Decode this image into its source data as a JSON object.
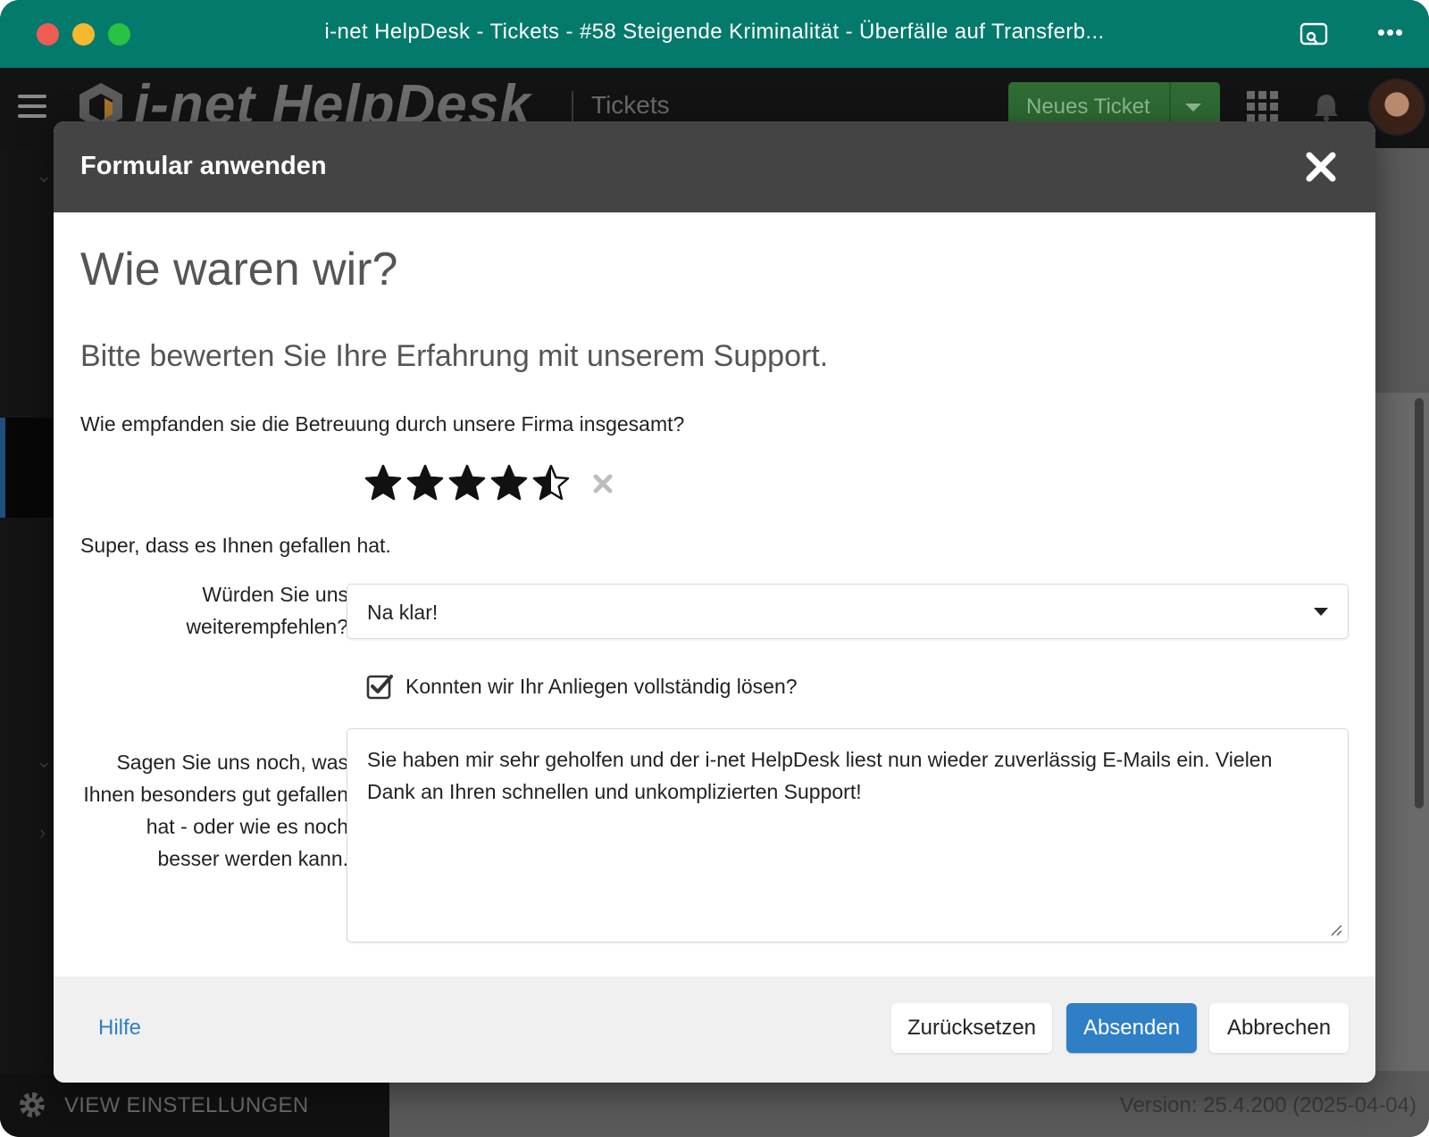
{
  "window": {
    "title": "i-net HelpDesk - Tickets - #58 Steigende Kriminalität - Überfälle auf Transferb..."
  },
  "appbar": {
    "logo_text": "i-net HelpDesk",
    "section": "Tickets",
    "new_ticket_label": "Neues Ticket"
  },
  "sidebar": {
    "footer_label": "VIEW EINSTELLUNGEN"
  },
  "status": {
    "version": "Version: 25.4.200 (2025-04-04)"
  },
  "modal": {
    "title": "Formular anwenden",
    "heading": "Wie waren wir?",
    "subheading": "Bitte bewerten Sie Ihre Erfahrung mit unserem Support.",
    "rating": {
      "question": "Wie empfanden sie die Betreuung durch unsere Firma insgesamt?",
      "value": 4.5,
      "max": 5,
      "feedback": "Super, dass es Ihnen gefallen hat."
    },
    "recommend": {
      "label": "Würden Sie uns weiterempfehlen?",
      "value": "Na klar!"
    },
    "resolved": {
      "label": "Konnten wir Ihr Anliegen vollständig lösen?",
      "checked": true
    },
    "comment": {
      "label": "Sagen Sie uns noch, was Ihnen besonders gut gefallen hat - oder wie es noch besser werden kann.",
      "value": "Sie haben mir sehr geholfen und der i-net HelpDesk liest nun wieder zuverlässig E-Mails ein. Vielen Dank an Ihren schnellen und unkomplizierten Support!"
    },
    "footer": {
      "help": "Hilfe",
      "reset": "Zurücksetzen",
      "submit": "Absenden",
      "cancel": "Abbrechen"
    }
  },
  "colors": {
    "titlebar": "#047a6c",
    "primary": "#2f7fc7",
    "modal_header": "#444444"
  }
}
